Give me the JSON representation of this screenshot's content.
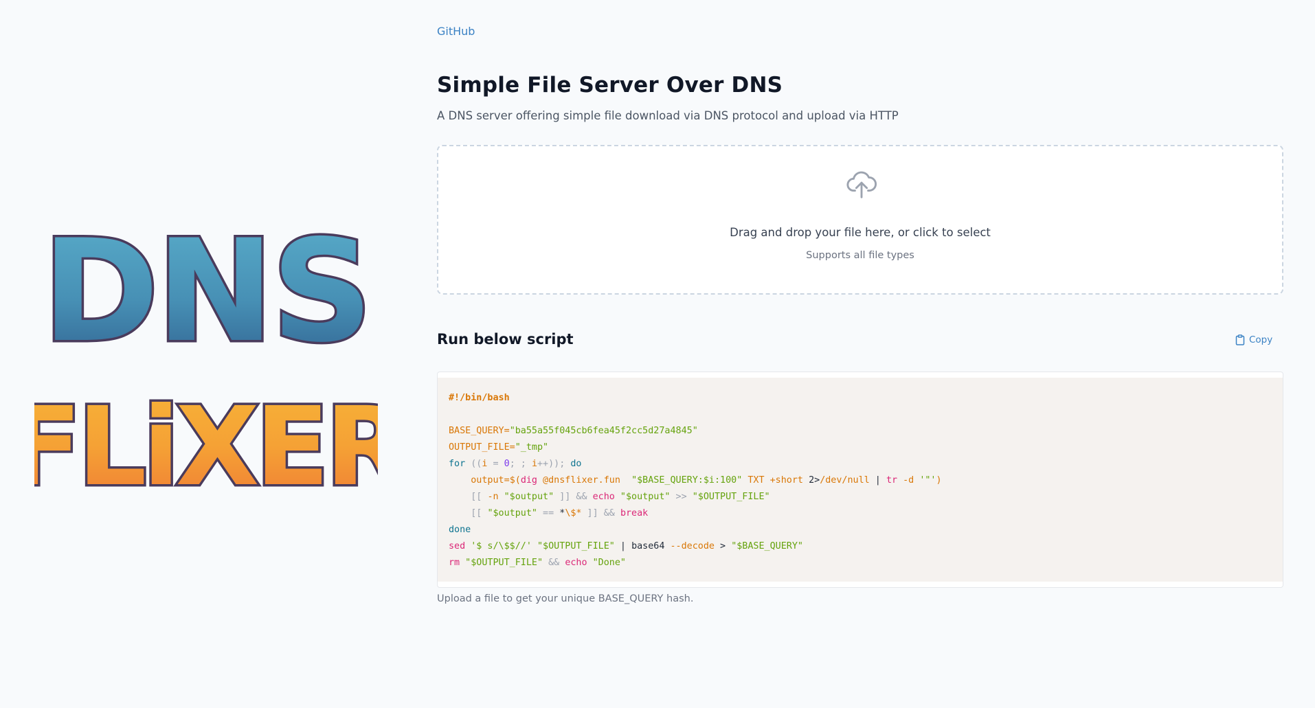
{
  "nav": {
    "github_label": "GitHub"
  },
  "header": {
    "title": "Simple File Server Over DNS",
    "subtitle": "A DNS server offering simple file download via DNS protocol and upload via HTTP"
  },
  "logo": {
    "line1": "DNS",
    "line2": "FLiXER"
  },
  "dropzone": {
    "icon": "cloud-upload-icon",
    "main_text": "Drag and drop your file here, or click to select",
    "sub_text": "Supports all file types"
  },
  "script_section": {
    "title": "Run below script",
    "copy_label": "Copy",
    "copy_icon": "clipboard-icon"
  },
  "code": {
    "l1": "#!/bin/bash",
    "l2a": "BASE_QUERY=",
    "l2b": "\"ba55a55f045cb6fea45f2cc5d27a4845\"",
    "l3a": "OUTPUT_FILE=",
    "l3b": "\"_tmp\"",
    "l4a": "for",
    "l4b": " ((",
    "l4c": "i",
    "l4d": " = ",
    "l4e": "0",
    "l4f": "; ; ",
    "l4g": "i",
    "l4h": "++)); ",
    "l4i": "do",
    "l5a": "    output=",
    "l5b": "$(",
    "l5c": "dig",
    "l5d": " @dnsflixer.fun  ",
    "l5e": "\"$BASE_QUERY:$i:100\"",
    "l5f": " TXT +short ",
    "l5g": "2>",
    "l5h": "/dev/null",
    "l5i": " | ",
    "l5j": "tr",
    "l5k": " -d ",
    "l5l": "'\"'",
    "l5m": ")",
    "l6a": "    [[ ",
    "l6b": "-n",
    "l6c": " \"$output\"",
    "l6d": " ]] && ",
    "l6e": "echo",
    "l6f": " \"$output\"",
    "l6g": " >> ",
    "l6h": "\"$OUTPUT_FILE\"",
    "l7a": "    [[ ",
    "l7b": "\"$output\"",
    "l7c": " == ",
    "l7d": "*",
    "l7e": "\\$*",
    "l7f": " ]] && ",
    "l7g": "break",
    "l8": "done",
    "l9a": "sed",
    "l9b": " '$ s/\\$$//'",
    "l9c": " \"$OUTPUT_FILE\"",
    "l9d": " | ",
    "l9e": "base64",
    "l9f": " --decode",
    "l9g": " > ",
    "l9h": "\"$BASE_QUERY\"",
    "l10a": "rm",
    "l10b": " \"$OUTPUT_FILE\"",
    "l10c": " && ",
    "l10d": "echo",
    "l10e": " \"Done\""
  },
  "footnote": "Upload a file to get your unique BASE_QUERY hash.",
  "colors": {
    "background": "#f8fafc",
    "link": "#3b82c4",
    "code_bg": "#f5f2ef",
    "logo_blue": "#3f7fae",
    "logo_orange": "#f0953a"
  }
}
